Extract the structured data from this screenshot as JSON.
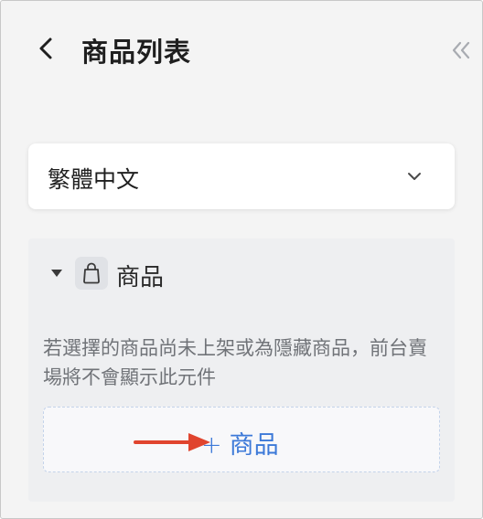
{
  "header": {
    "title": "商品列表",
    "back_icon": "chevron-left-icon",
    "collapse_icon": "double-chevron-left-icon"
  },
  "language_select": {
    "value": "繁體中文",
    "icon": "chevron-down-icon"
  },
  "product_section": {
    "title": "商品",
    "icon": "shopping-bag-icon",
    "note": "若選擇的商品尚未上架或為隱藏商品，前台賣場將不會顯示此元件",
    "add_button": {
      "plus": "+",
      "label": "商品"
    }
  },
  "colors": {
    "accent": "#3C79D8",
    "annotation_arrow": "#E0442E"
  }
}
